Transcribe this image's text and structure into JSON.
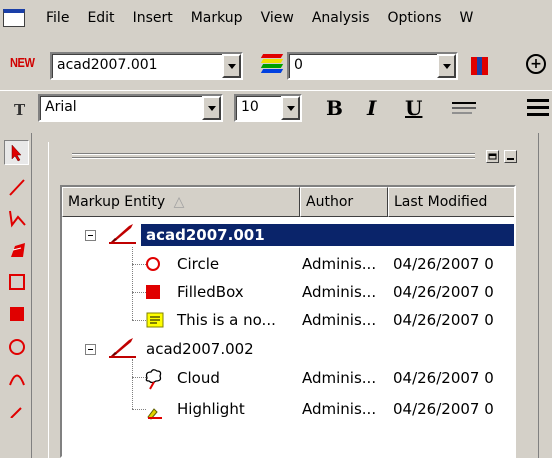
{
  "menubar": {
    "items": [
      "File",
      "Edit",
      "Insert",
      "Markup",
      "View",
      "Analysis",
      "Options",
      "W"
    ]
  },
  "toolbar1": {
    "new_label": "NEW",
    "file_combo": "acad2007.001",
    "layer_combo": "0"
  },
  "toolbar2": {
    "font_combo": "Arial",
    "size_combo": "10",
    "bold": "B",
    "italic": "I",
    "underline": "U"
  },
  "markup_list": {
    "columns": [
      "Markup Entity",
      "Author",
      "Last Modified"
    ],
    "groups": [
      {
        "name": "acad2007.001",
        "selected": true,
        "children": [
          {
            "entity": "Circle",
            "author": "Adminis...",
            "modified": "04/26/2007 0",
            "icon": "circle-markup-icon"
          },
          {
            "entity": "FilledBox",
            "author": "Adminis...",
            "modified": "04/26/2007 0",
            "icon": "filled-box-icon"
          },
          {
            "entity": "This is a no...",
            "author": "Adminis...",
            "modified": "04/26/2007 0",
            "icon": "note-icon"
          }
        ]
      },
      {
        "name": "acad2007.002",
        "selected": false,
        "children": [
          {
            "entity": "Cloud",
            "author": "Adminis...",
            "modified": "04/26/2007 0",
            "icon": "cloud-icon"
          },
          {
            "entity": "Highlight",
            "author": "Adminis...",
            "modified": "04/26/2007 0",
            "icon": "highlight-icon"
          }
        ]
      }
    ]
  },
  "colors": {
    "selection": "#0a246a",
    "markup_red": "#e00000",
    "chrome": "#d4d0c8"
  }
}
